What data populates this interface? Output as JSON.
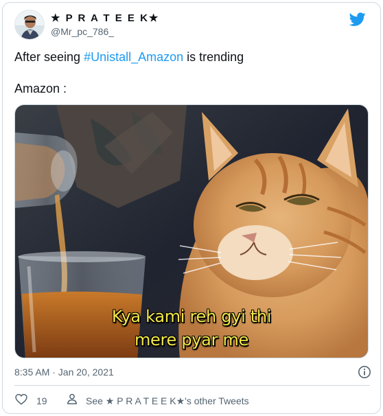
{
  "author": {
    "display_name": "★ P R A T E E K★",
    "handle": "@Mr_pc_786_"
  },
  "tweet": {
    "text_prefix": "After seeing ",
    "hashtag": "#Unistall_Amazon",
    "text_suffix": " is trending",
    "line2": "Amazon :"
  },
  "media": {
    "caption_line1": "Kya kami reh gyi thi",
    "caption_line2": "mere pyar me"
  },
  "meta": {
    "timestamp": "8:35 AM · Jan 20, 2021"
  },
  "actions": {
    "like_count": "19",
    "profile_link": "See ★ P R A T E E K★'s other Tweets"
  },
  "colors": {
    "accent": "#1d9bf0",
    "text": "#0f1419",
    "secondary": "#536471",
    "border": "#cfd9de",
    "caption": "#f3e84a"
  },
  "icons": [
    "twitter-bird-icon",
    "info-icon",
    "heart-icon",
    "person-icon"
  ]
}
